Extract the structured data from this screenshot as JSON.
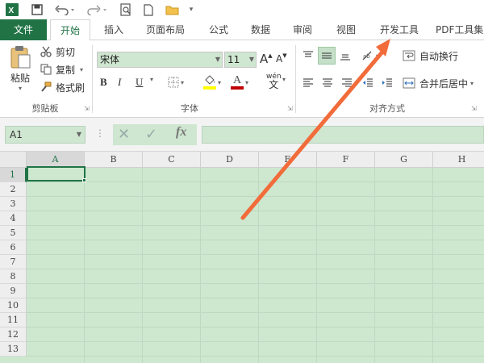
{
  "qat": {
    "excel_icon": "excel-logo-icon",
    "save_icon": "save-icon",
    "undo_icon": "undo-icon",
    "redo_icon": "redo-icon",
    "print_preview_icon": "print-preview-icon",
    "new_icon": "new-document-icon",
    "open_icon": "open-folder-icon"
  },
  "tabs": [
    {
      "label": "文件"
    },
    {
      "label": "开始"
    },
    {
      "label": "插入"
    },
    {
      "label": "页面布局"
    },
    {
      "label": "公式"
    },
    {
      "label": "数据"
    },
    {
      "label": "审阅"
    },
    {
      "label": "视图"
    },
    {
      "label": "开发工具"
    },
    {
      "label": "PDF工具集"
    }
  ],
  "clipboard": {
    "paste_label": "粘贴",
    "cut_label": "剪切",
    "copy_label": "复制",
    "format_painter_label": "格式刷",
    "group_label": "剪贴板"
  },
  "font": {
    "name": "宋体",
    "size": "11",
    "bold": "B",
    "italic": "I",
    "underline": "U",
    "grow": "A",
    "shrink": "A",
    "phonetic": "wén",
    "group_label": "字体",
    "fill_color": "#ffff00",
    "font_color": "#c00000"
  },
  "alignment": {
    "wrap_label": "自动换行",
    "merge_label": "合并后居中",
    "group_label": "对齐方式"
  },
  "formula_bar": {
    "name_box": "A1",
    "fx": "fx"
  },
  "grid": {
    "columns": [
      "A",
      "B",
      "C",
      "D",
      "E",
      "F",
      "G",
      "H"
    ],
    "rows": [
      "1",
      "2",
      "3",
      "4",
      "5",
      "6",
      "7",
      "8",
      "9",
      "10",
      "11",
      "12",
      "13"
    ]
  },
  "colors": {
    "accent": "#217346",
    "arrow": "#f26b3a",
    "cell_fill": "#cde8cf"
  }
}
